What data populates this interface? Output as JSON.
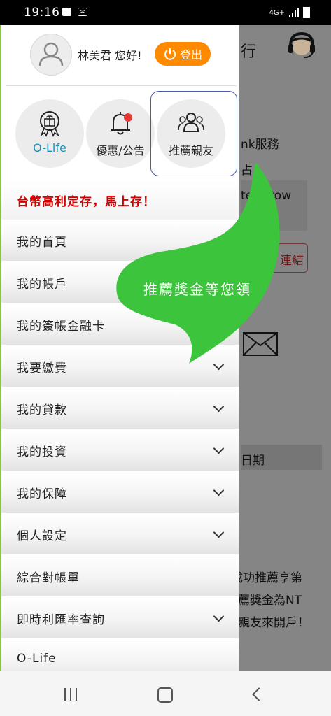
{
  "status_bar": {
    "time": "19:16",
    "network": "4G+"
  },
  "background": {
    "title_fragment": "行",
    "service_text": "nk服務",
    "fragment_a": "占",
    "input_text": "ter  Brow",
    "link_text": "連結",
    "date_header": "日期",
    "promo_line1": "成功推薦享第",
    "promo_line2": "薦獎金為NT",
    "promo_line3": "親友來開戶！"
  },
  "drawer": {
    "greeting": "林美君 您好!",
    "logout_label": "登出",
    "quick_links": [
      {
        "label": "O-Life",
        "icon": "gift-badge-icon",
        "color": "#1a8fb8"
      },
      {
        "label": "優惠/公告",
        "icon": "bell-icon",
        "color": "#222222"
      },
      {
        "label": "推薦親友",
        "icon": "group-icon",
        "color": "#222222"
      }
    ],
    "promo_banner": "台幣高利定存，馬上存！",
    "menu": [
      {
        "label": "我的首頁",
        "expandable": false
      },
      {
        "label": "我的帳戶",
        "expandable": false
      },
      {
        "label": "我的簽帳金融卡",
        "expandable": false
      },
      {
        "label": "我要繳費",
        "expandable": true
      },
      {
        "label": "我的貸款",
        "expandable": true
      },
      {
        "label": "我的投資",
        "expandable": true
      },
      {
        "label": "我的保障",
        "expandable": true
      },
      {
        "label": "個人設定",
        "expandable": true
      },
      {
        "label": "綜合對帳單",
        "expandable": false
      },
      {
        "label": "即時利匯率查詢",
        "expandable": true
      },
      {
        "label": "O-Life",
        "expandable": false
      }
    ]
  },
  "overlay": {
    "text": "推薦獎金等您領",
    "color": "#3dc43d"
  },
  "colors": {
    "accent": "#ff8a00",
    "promo": "#d40000",
    "badge": "#e53935"
  }
}
